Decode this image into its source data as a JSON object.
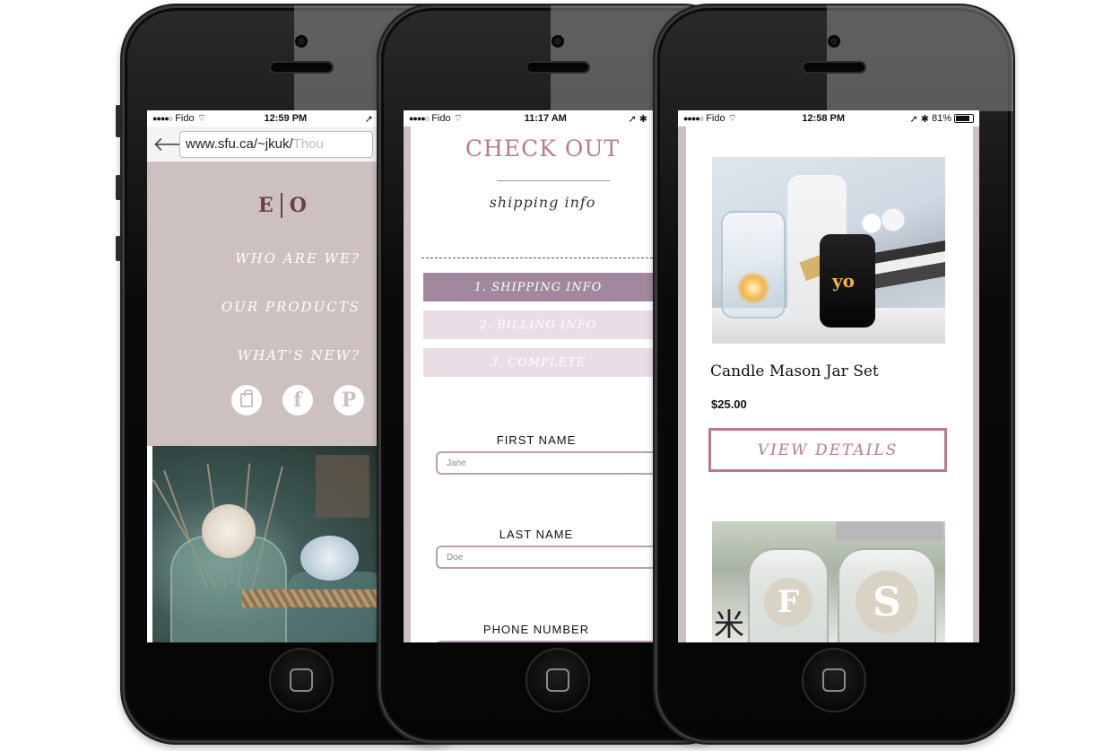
{
  "status_bars": [
    {
      "signal": "●●●●○",
      "carrier": "Fido",
      "wifi": "wifi",
      "time": "12:59 PM",
      "right": "➚"
    },
    {
      "signal": "●●●●○",
      "carrier": "Fido",
      "wifi": "wifi",
      "time": "11:17 AM",
      "right": "➚ ✱"
    },
    {
      "signal": "●●●●○",
      "carrier": "Fido",
      "wifi": "wifi",
      "time": "12:58 PM",
      "right": "➚ ✱",
      "battery": "81%",
      "battery_level": 0.81
    }
  ],
  "browser": {
    "url_visible": "www.sfu.ca/~jkuk/",
    "url_faded": "Thou"
  },
  "menu": {
    "logo_left": "E",
    "logo_right": "O",
    "links": [
      "WHO ARE WE?",
      "OUR PRODUCTS",
      "WHAT'S NEW?"
    ],
    "social_icons": [
      "shopping-bag-icon",
      "facebook-icon",
      "pinterest-icon"
    ]
  },
  "checkout": {
    "title": "CHECK OUT",
    "subtitle": "shipping info",
    "steps": [
      {
        "label": "1. SHIPPING INFO",
        "active": true
      },
      {
        "label": "2. BILLING INFO",
        "active": false
      },
      {
        "label": "3. COMPLETE",
        "active": false
      }
    ],
    "fields": [
      {
        "label": "FIRST NAME",
        "value": "Jane"
      },
      {
        "label": "LAST NAME",
        "value": "Doe"
      },
      {
        "label": "PHONE NUMBER",
        "value": ""
      }
    ]
  },
  "product": {
    "name": "Candle Mason Jar Set",
    "price": "$25.00",
    "button_label": "VIEW DETAILS",
    "jar_label": "yo",
    "second_letters": [
      "F",
      "S"
    ],
    "second_symbol": "米"
  },
  "colors": {
    "accent_pink": "#b77c8c",
    "step_active": "#a1889f",
    "step_inactive": "#eadde6",
    "menu_bg": "#ccc1bf",
    "logo": "#6b3e48"
  }
}
